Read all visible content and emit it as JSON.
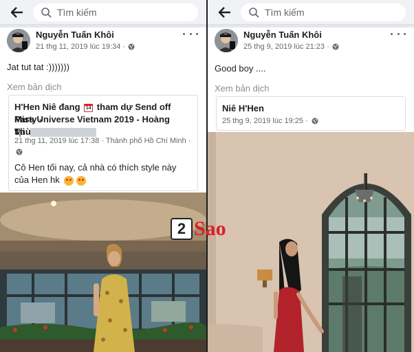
{
  "left": {
    "search_placeholder": "Tìm kiếm",
    "author": "Nguyễn Tuấn Khôi",
    "timestamp": "21 thg 11, 2019 lúc 19:34 ·",
    "post_text": "Jat tut tat :)))))))",
    "see_translation": "Xem bản dịch",
    "shared": {
      "title_line1": "H'Hen Niê đang",
      "calendar_day": "14",
      "title_line1_rest": "tham dự Send off Party -",
      "title_line2": "Miss Universe Vietnam 2019 - Hoàng Thùy",
      "title_line3": "tại",
      "meta": "21 thg 11, 2019 lúc 17:38 · Thành phố Hồ Chí Minh ·",
      "text_line1": "Cô Hen tối nay, cả nhà có thích style này",
      "text_line2": "của Hen hk"
    }
  },
  "right": {
    "search_placeholder": "Tìm kiếm",
    "author": "Nguyễn Tuấn Khôi",
    "timestamp": "25 thg 9, 2019 lúc 21:23 ·",
    "post_text": "Good boy ....",
    "see_translation": "Xem bản dịch",
    "shared": {
      "name": "Niê H'Hen",
      "meta": "25 thg 9, 2019 lúc 19:25 ·"
    }
  },
  "watermark": {
    "box": "2",
    "text": "Sao"
  },
  "colors": {
    "link_gray": "#8a8d91",
    "meta_gray": "#65676b",
    "brand_red": "#d9202a"
  }
}
